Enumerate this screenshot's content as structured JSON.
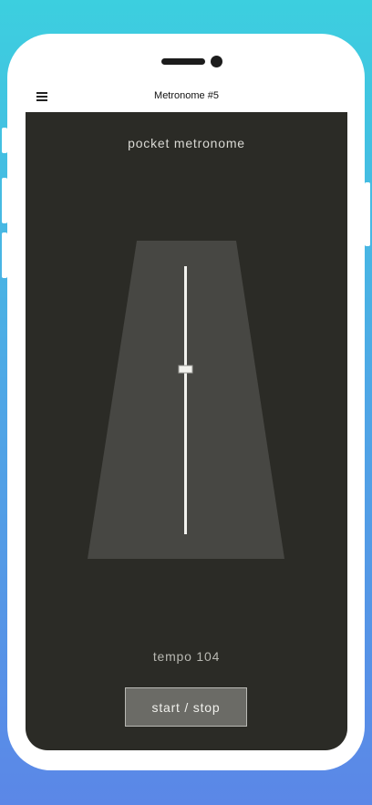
{
  "app_bar": {
    "title": "Metronome #5",
    "menu_icon": "hamburger-menu-icon"
  },
  "screen": {
    "heading": "pocket metronome",
    "tempo_label": "tempo 104",
    "start_stop_label": "start / stop"
  },
  "colors": {
    "background_gradient_top": "#3ccfdf",
    "background_gradient_bottom": "#5b87e7",
    "screen_bg": "#2b2b26",
    "trapezoid": "#474743",
    "pendulum": "#f2f2ee",
    "button_bg": "#6b6b66"
  }
}
